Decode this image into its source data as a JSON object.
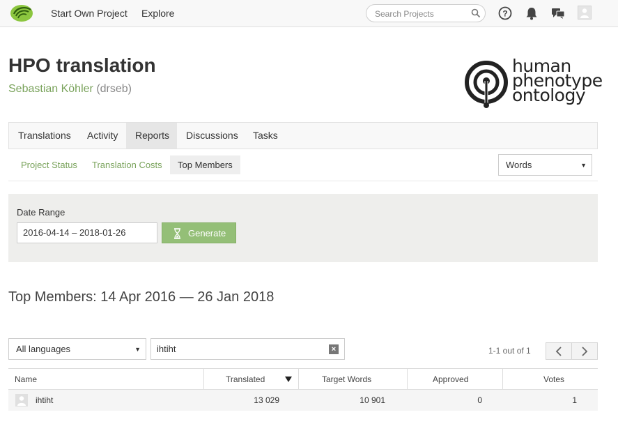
{
  "topbar": {
    "nav": [
      "Start Own Project",
      "Explore"
    ],
    "search_placeholder": "Search Projects",
    "icons": [
      "help-icon",
      "bell-icon",
      "chat-icon",
      "user-avatar"
    ]
  },
  "project": {
    "title": "HPO translation",
    "owner_name": "Sebastian Köhler",
    "owner_handle": "(drseb)",
    "logo_text": [
      "human",
      "phenotype",
      "ontology"
    ]
  },
  "tabs": [
    {
      "label": "Translations",
      "active": false
    },
    {
      "label": "Activity",
      "active": false
    },
    {
      "label": "Reports",
      "active": true
    },
    {
      "label": "Discussions",
      "active": false
    },
    {
      "label": "Tasks",
      "active": false
    }
  ],
  "subtabs": [
    {
      "label": "Project Status",
      "active": false
    },
    {
      "label": "Translation Costs",
      "active": false
    },
    {
      "label": "Top Members",
      "active": true
    }
  ],
  "unit_select": {
    "value": "Words"
  },
  "date_range": {
    "label": "Date Range",
    "value": "2016-04-14 – 2018-01-26",
    "generate_label": "Generate"
  },
  "report_title": "Top Members: 14 Apr 2016 — 26 Jan 2018",
  "filters": {
    "language": "All languages",
    "member_search": "ihtiht",
    "pager_info": "1-1 out of 1"
  },
  "table": {
    "headers": [
      "Name",
      "Translated",
      "Target Words",
      "Approved",
      "Votes"
    ],
    "sort_column": "Translated",
    "rows": [
      {
        "name": "ihtiht",
        "translated": "13 029",
        "target_words": "10 901",
        "approved": "0",
        "votes": "1"
      }
    ]
  },
  "colors": {
    "accent_green": "#7aa35c",
    "button_green": "#94bf77",
    "panel_bg": "#eeeeec",
    "topbar_bg": "#f8f8f8"
  }
}
